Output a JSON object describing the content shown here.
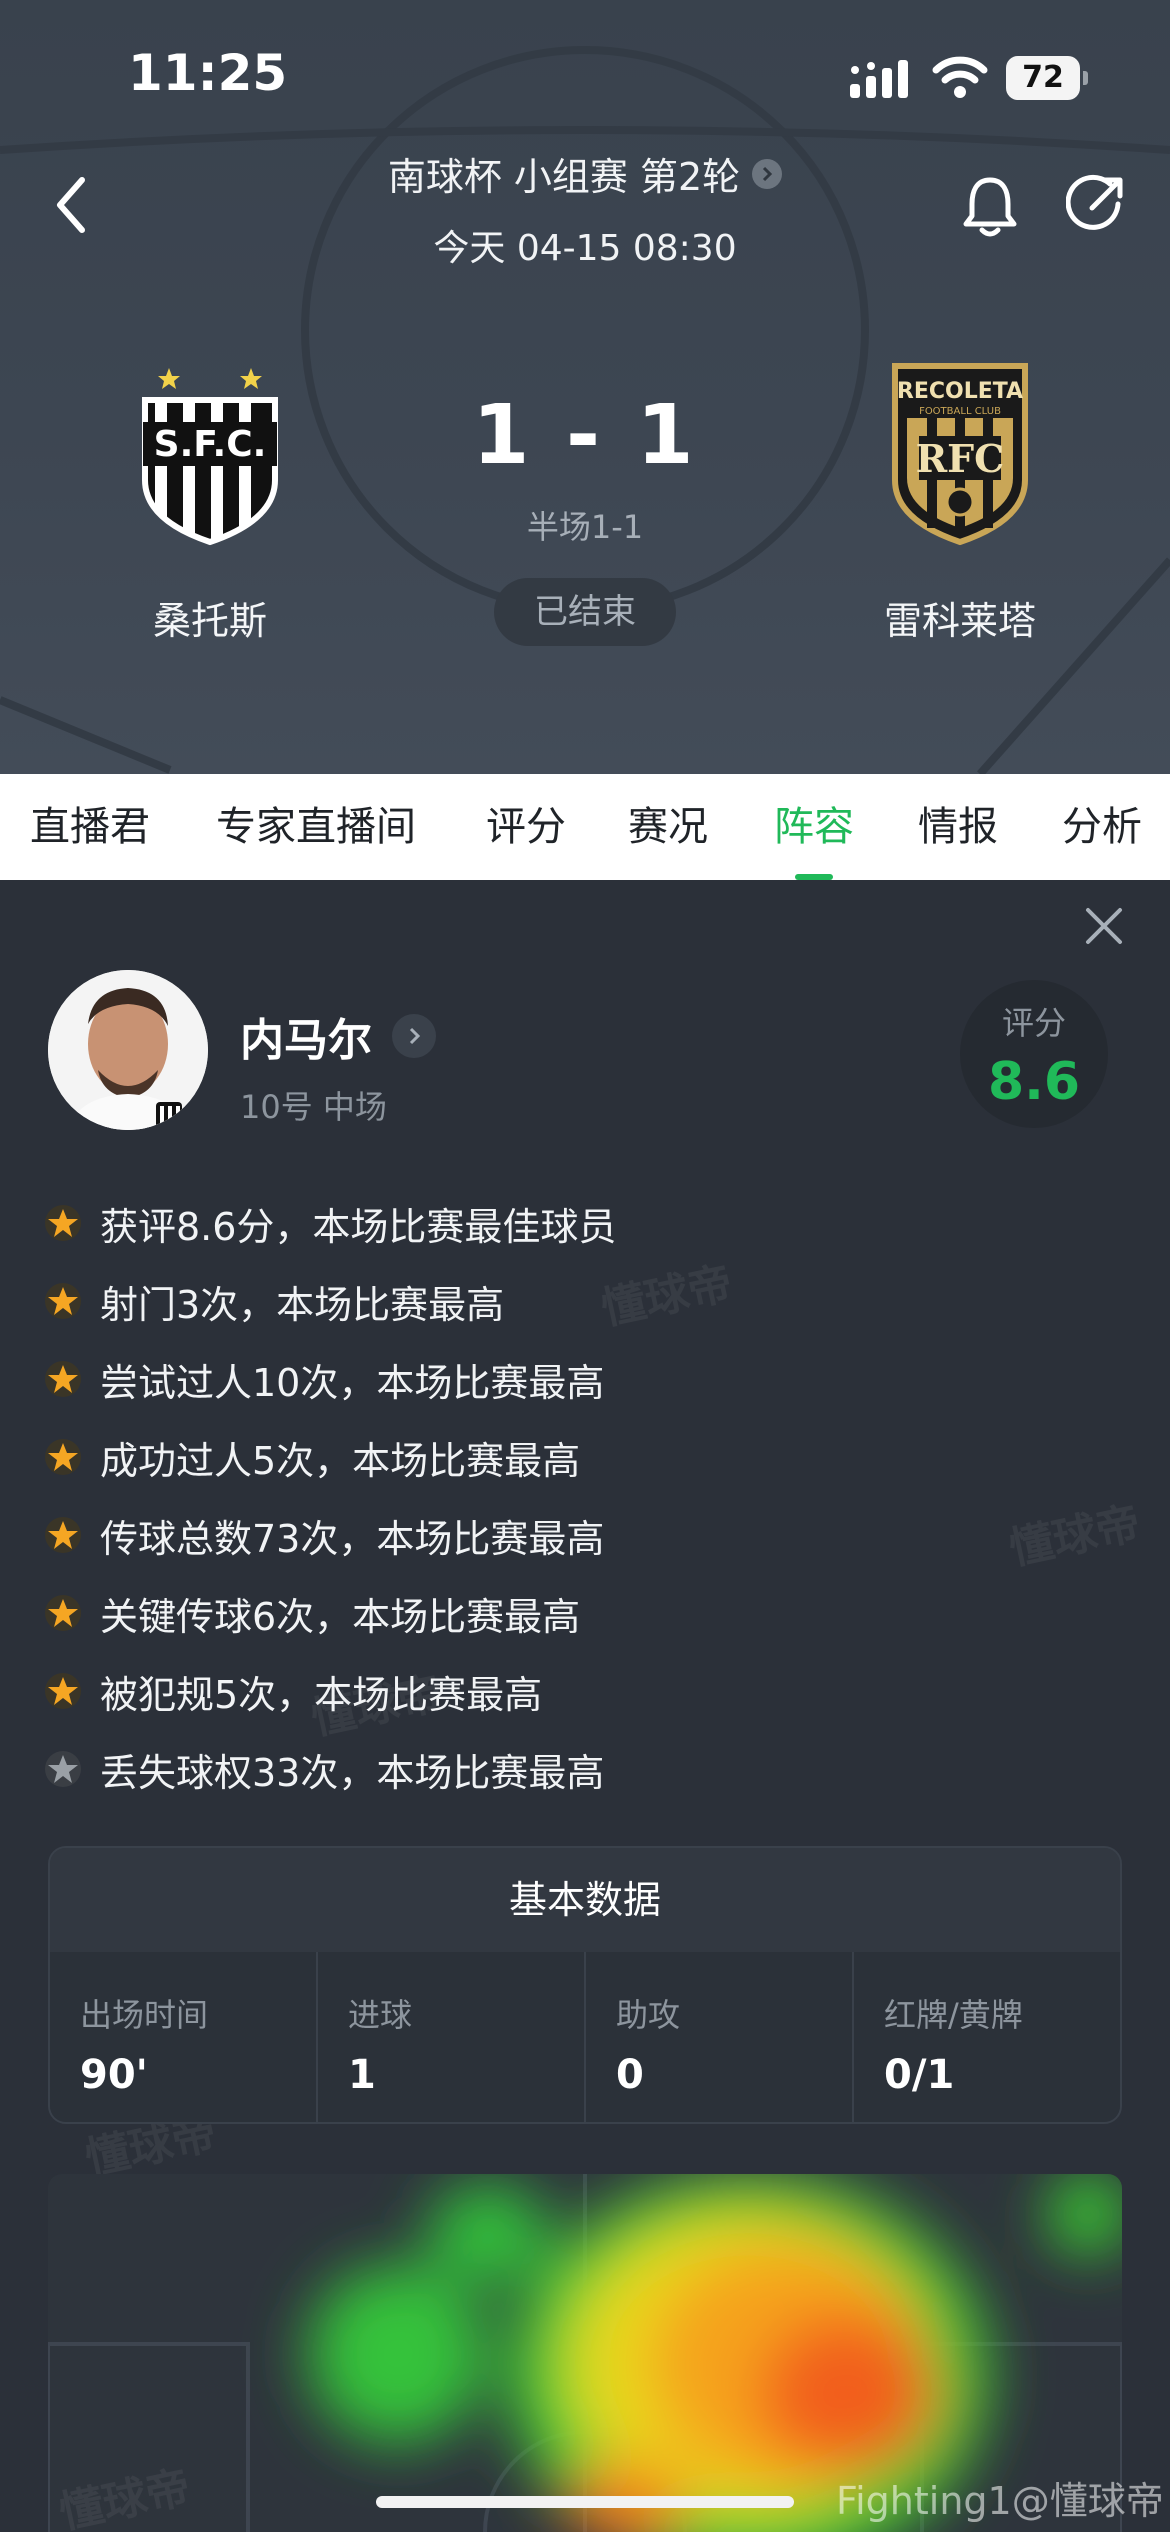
{
  "status_bar": {
    "time": "11:25",
    "battery": "72"
  },
  "header": {
    "competition": "南球杯 小组赛 第2轮",
    "kickoff": "今天 04-15 08:30"
  },
  "match": {
    "home": {
      "name": "桑托斯",
      "crest_text": "S.F.C."
    },
    "away": {
      "name": "雷科莱塔",
      "crest_top": "RECOLETA",
      "crest_sub": "FOOTBALL CLUB",
      "crest_text": "RFC"
    },
    "score": "1 - 1",
    "half_time": "半场1-1",
    "status": "已结束"
  },
  "tabs": [
    {
      "label": "直播君"
    },
    {
      "label": "专家直播间"
    },
    {
      "label": "评分"
    },
    {
      "label": "赛况"
    },
    {
      "label": "阵容",
      "active": true
    },
    {
      "label": "情报"
    },
    {
      "label": "分析"
    }
  ],
  "player": {
    "name": "内马尔",
    "meta": "10号 中场",
    "rating_label": "评分",
    "rating": "8.6"
  },
  "highlights": [
    {
      "text": "获评8.6分，本场比赛最佳球员",
      "star": "gold"
    },
    {
      "text": "射门3次，本场比赛最高",
      "star": "gold"
    },
    {
      "text": "尝试过人10次，本场比赛最高",
      "star": "gold"
    },
    {
      "text": "成功过人5次，本场比赛最高",
      "star": "gold"
    },
    {
      "text": "传球总数73次，本场比赛最高",
      "star": "gold"
    },
    {
      "text": "关键传球6次，本场比赛最高",
      "star": "gold"
    },
    {
      "text": "被犯规5次，本场比赛最高",
      "star": "gold"
    },
    {
      "text": "丢失球权33次，本场比赛最高",
      "star": "silver"
    }
  ],
  "basic_stats": {
    "title": "基本数据",
    "items": [
      {
        "label": "出场时间",
        "value": "90'"
      },
      {
        "label": "进球",
        "value": "1"
      },
      {
        "label": "助攻",
        "value": "0"
      },
      {
        "label": "红牌/黄牌",
        "value": "0/1"
      }
    ]
  },
  "watermark": "懂球帝",
  "credit": "Fighting1@懂球帝",
  "colors": {
    "accent": "#20b959",
    "star_gold": "#f5a623",
    "star_silver": "#9aa0a6"
  }
}
